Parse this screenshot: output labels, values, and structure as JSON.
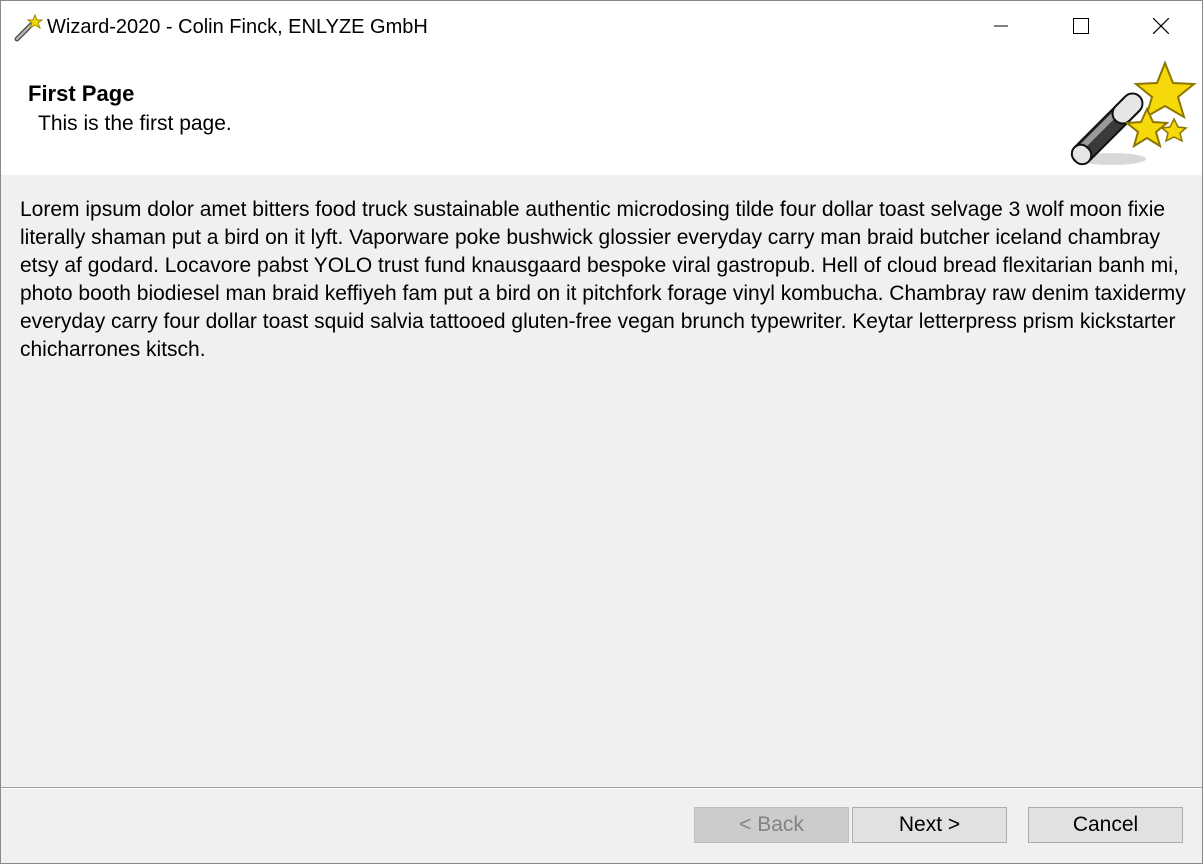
{
  "window": {
    "title": "Wizard-2020 - Colin Finck, ENLYZE GmbH",
    "app_icon": "wizard-wand-icon",
    "controls": {
      "minimize_icon": "minimize-icon",
      "maximize_icon": "maximize-icon",
      "close_icon": "close-icon"
    }
  },
  "header": {
    "title": "First Page",
    "subtitle": "This is the first page.",
    "graphic": "wizard-wand-stars-icon"
  },
  "content": {
    "text": "Lorem ipsum dolor amet bitters food truck sustainable authentic microdosing tilde four dollar toast selvage 3 wolf moon fixie literally shaman put a bird on it lyft. Vaporware poke bushwick glossier everyday carry man braid butcher iceland chambray etsy af godard. Locavore pabst YOLO trust fund knausgaard bespoke viral gastropub. Hell of cloud bread flexitarian banh mi, photo booth biodiesel man braid keffiyeh fam put a bird on it pitchfork forage vinyl kombucha. Chambray raw denim taxidermy everyday carry four dollar toast squid salvia tattooed gluten-free vegan brunch typewriter. Keytar letterpress prism kickstarter chicharrones kitsch."
  },
  "footer": {
    "back_label": "< Back",
    "back_enabled": false,
    "next_label": "Next >",
    "cancel_label": "Cancel"
  },
  "colors": {
    "header_bg": "#ffffff",
    "content_bg": "#f0f0f0",
    "button_bg": "#e1e1e1",
    "star_yellow": "#f5d90a"
  }
}
